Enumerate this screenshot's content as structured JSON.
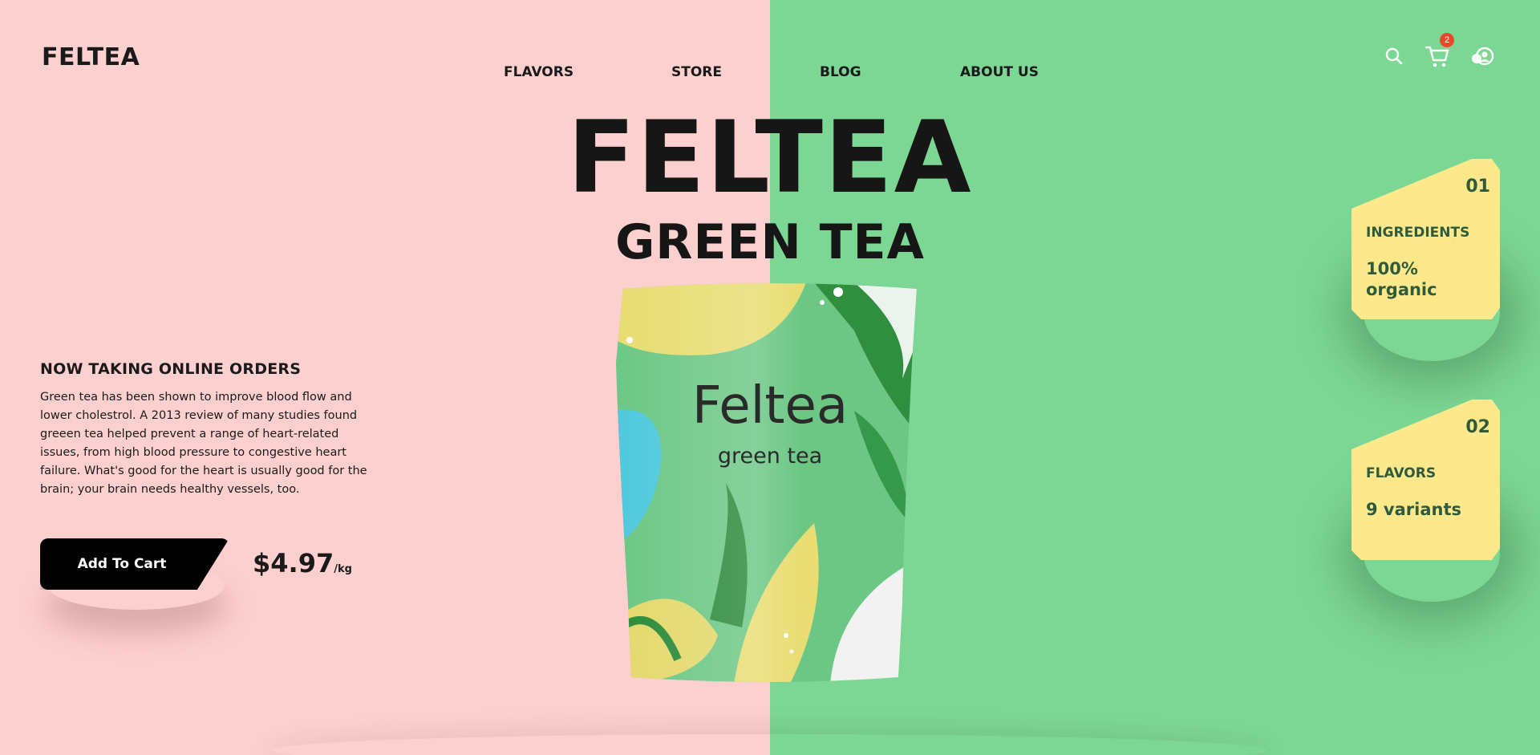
{
  "brand": {
    "logo": "FELTEA"
  },
  "nav": {
    "items": [
      "FLAVORS",
      "STORE",
      "BLOG",
      "ABOUT US"
    ]
  },
  "header_icons": {
    "search": "search-icon",
    "cart": "cart-icon",
    "account": "account-icon",
    "cart_count": "2"
  },
  "hero": {
    "title": "FELTEA",
    "subtitle": "GREEN TEA"
  },
  "product": {
    "pack_brand": "Feltea",
    "pack_name": "green tea"
  },
  "orders": {
    "heading": "NOW TAKING ONLINE ORDERS",
    "body": "Green tea has been shown to improve blood flow and lower cholestrol. A 2013 review of many studies found greeen tea helped prevent a range of heart-related issues, from high blood pressure to congestive heart failure. What's good for the heart is usually good for the brain; your brain needs healthy vessels, too."
  },
  "purchase": {
    "button_label": "Add To Cart",
    "price": "$4.97",
    "unit": "/kg"
  },
  "cards": [
    {
      "number": "01",
      "label": "INGREDIENTS",
      "value": "100% organic"
    },
    {
      "number": "02",
      "label": "FLAVORS",
      "value": "9 variants"
    }
  ],
  "colors": {
    "left_bg": "#fdd0d0",
    "right_bg": "#7dd794",
    "card_bg": "#fde98b",
    "card_text": "#2f5a3c",
    "badge": "#e7492a"
  }
}
